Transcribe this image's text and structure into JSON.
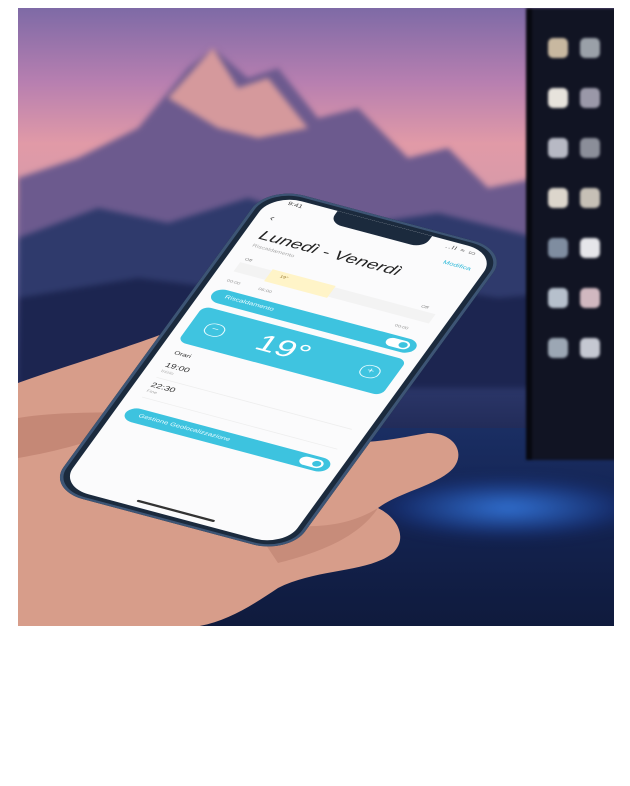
{
  "colors": {
    "accent": "#3dc3df",
    "screen_bg": "#fbfbfc",
    "desk_glow": "#3c8cff"
  },
  "status_bar": {
    "time": "9:41",
    "icons": "..ll ≈ ▭"
  },
  "header": {
    "back_icon": "chevron-left-icon",
    "action_label": "Modifica"
  },
  "schedule": {
    "title": "Lunedì - Venerdì",
    "subtitle": "Riscaldamento"
  },
  "timeline": {
    "labels": [
      "Off",
      "",
      "",
      "Off"
    ],
    "active_value": "19°",
    "times": [
      "00:00",
      "06:00",
      "",
      "00:00"
    ]
  },
  "heating_bar": {
    "label": "Riscaldamento",
    "enabled": true
  },
  "temperature": {
    "value": "19°",
    "decrease_icon": "minus-circle-icon",
    "increase_icon": "plus-circle-icon"
  },
  "hours": {
    "section_label": "Orari",
    "rows": [
      {
        "time": "19:00",
        "caption": "Inizio"
      },
      {
        "time": "22:30",
        "caption": "Fine"
      }
    ]
  },
  "geo_bar": {
    "label": "Gestione Geolocalizzazione",
    "enabled": true
  }
}
